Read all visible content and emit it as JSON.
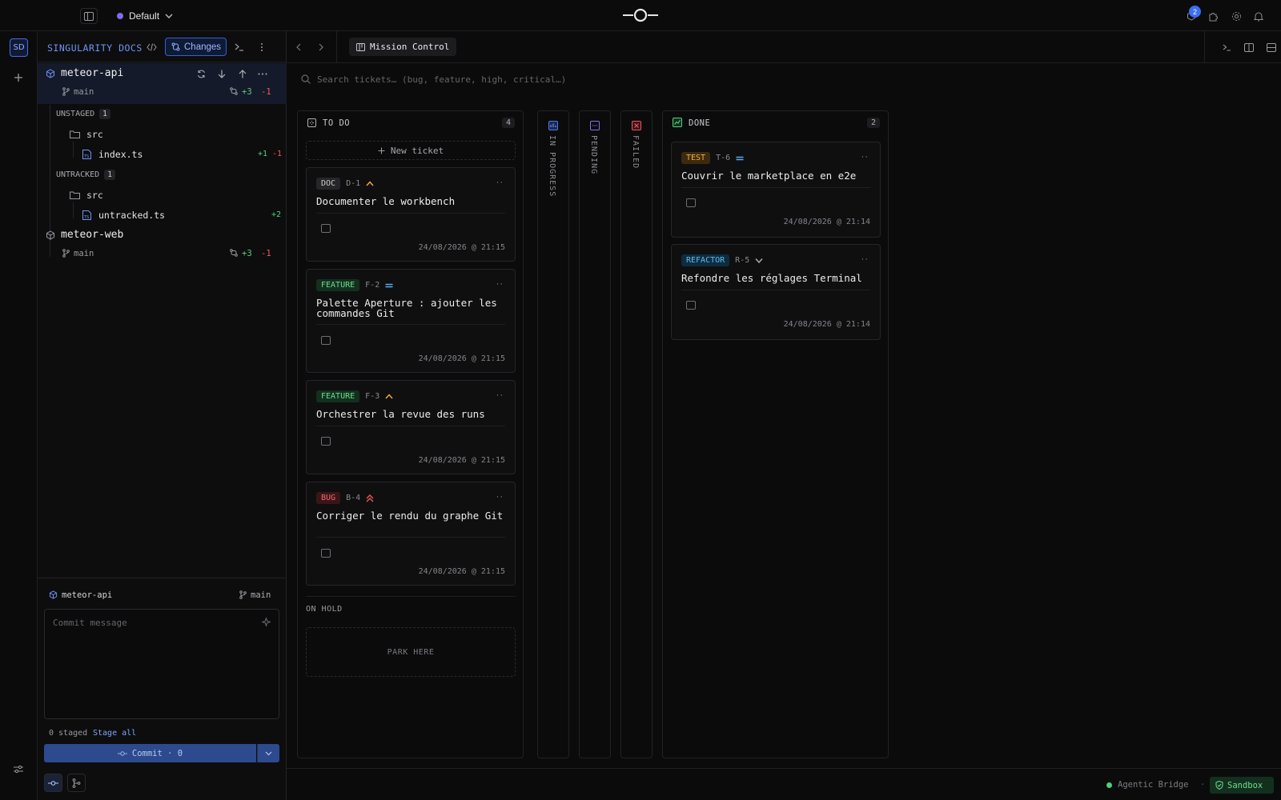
{
  "topbar": {
    "workspace_label": "Default",
    "workspace_dot_color": "#7c6cf0",
    "notifications_badge": "2"
  },
  "rail": {
    "workspace_initials": "SD"
  },
  "left_panel": {
    "title": "SINGULARITY DOCS",
    "changes_label": "Changes",
    "repos": [
      {
        "name": "meteor-api",
        "branch": "main",
        "additions": "+3",
        "deletions": "-1",
        "unstaged_label": "UNSTAGED",
        "unstaged_count": "1",
        "unstaged_folder": "src",
        "unstaged_file": "index.ts",
        "unstaged_file_add": "+1",
        "unstaged_file_del": "-1",
        "unstaged_file_status": "M",
        "untracked_label": "UNTRACKED",
        "untracked_count": "1",
        "untracked_folder": "src",
        "untracked_file": "untracked.ts",
        "untracked_file_add": "+2",
        "untracked_file_status": "U"
      },
      {
        "name": "meteor-web",
        "branch": "main",
        "additions": "+3",
        "deletions": "-1"
      }
    ],
    "commit_box": {
      "repo": "meteor-api",
      "branch": "main",
      "placeholder": "Commit message",
      "staged_text": "0 staged",
      "stage_all": "Stage all",
      "commit_label": "Commit · 0"
    }
  },
  "main": {
    "tab_label": "Mission Control",
    "search_placeholder": "Search tickets… (bug, feature, high, critical…)",
    "todo": {
      "title": "TO DO",
      "count": "4",
      "new_ticket": "New ticket",
      "cards": [
        {
          "type": "DOC",
          "id": "D-1",
          "title": "Documenter le workbench",
          "date": "24/08/2026 @ 21:15"
        },
        {
          "type": "FEATURE",
          "id": "F-2",
          "title": "Palette Aperture : ajouter les commandes Git",
          "date": "24/08/2026 @ 21:15"
        },
        {
          "type": "FEATURE",
          "id": "F-3",
          "title": "Orchestrer la revue des runs",
          "date": "24/08/2026 @ 21:15"
        },
        {
          "type": "BUG",
          "id": "B-4",
          "title": "Corriger le rendu du graphe Git",
          "date": "24/08/2026 @ 21:15"
        }
      ],
      "on_hold_label": "ON HOLD",
      "park_here": "PARK HERE"
    },
    "in_progress_label": "IN PROGRESS",
    "pending_label": "PENDING",
    "failed_label": "FAILED",
    "done": {
      "title": "DONE",
      "count": "2",
      "cards": [
        {
          "type": "TEST",
          "id": "T-6",
          "title": "Couvrir le marketplace en e2e",
          "date": "24/08/2026 @ 21:14"
        },
        {
          "type": "REFACTOR",
          "id": "R-5",
          "title": "Refondre les réglages Terminal",
          "date": "24/08/2026 @ 21:14"
        }
      ]
    },
    "status": {
      "bridge_label": "Agentic Bridge",
      "separator": "·",
      "sandbox_label": "Sandbox"
    }
  }
}
